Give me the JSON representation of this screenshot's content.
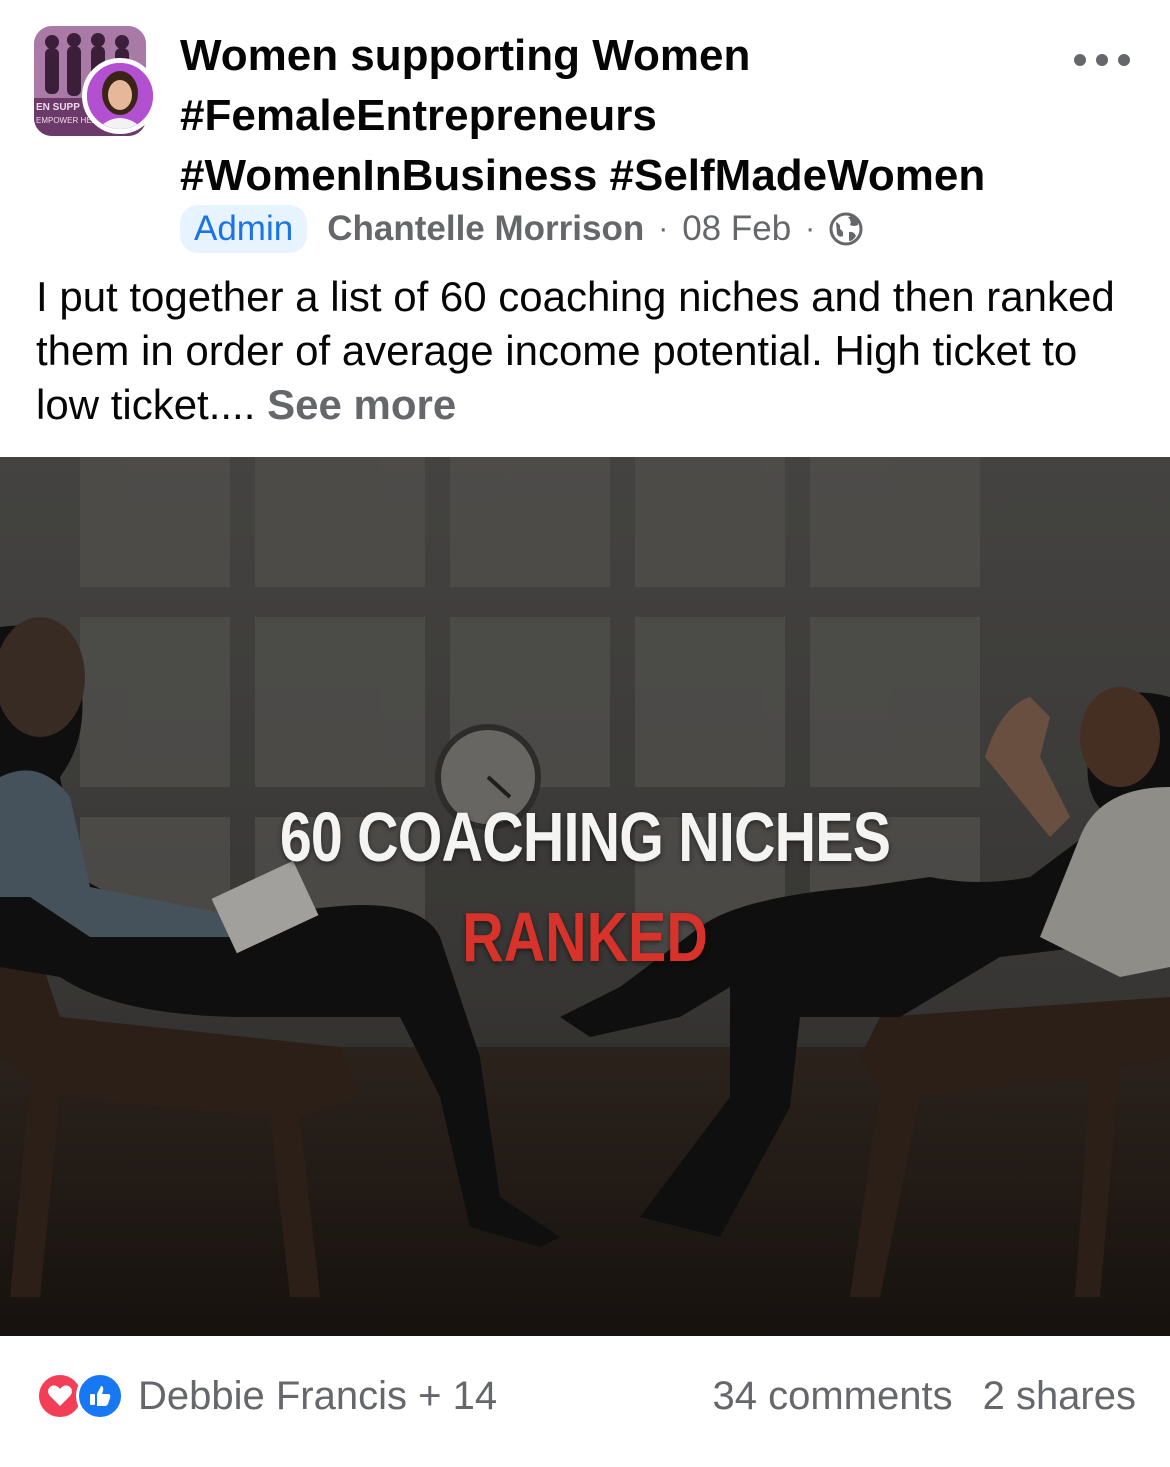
{
  "post": {
    "group_name": "Women supporting Women #FemaleEntrepreneurs #WomenInBusiness #SelfMadeWomen",
    "group_avatar_text": [
      "EN SUPP",
      "EMPOWER HER"
    ],
    "admin_badge": "Admin",
    "author": "Chantelle Morrison",
    "separator": "·",
    "date": "08 Feb",
    "privacy_icon": "globe-icon",
    "more_icon": "more-options-icon",
    "text": "I put together a list of 60 coaching niches and then ranked them in order of average income potential. High ticket to low ticket....",
    "see_more": "See more",
    "image": {
      "title": "60 COACHING NICHES",
      "subtitle": "RANKED"
    },
    "reactions": {
      "icons": [
        "love-icon",
        "like-icon"
      ],
      "summary": "Debbie Francis + 14"
    },
    "comments": "34 comments",
    "shares": "2 shares"
  },
  "colors": {
    "secondary_text": "#65676b",
    "admin_badge_bg": "#e7f3ff",
    "admin_badge_text": "#1b74e4",
    "love": "#f33e58",
    "like": "#1877f2",
    "image_subtitle": "#d7332b"
  }
}
